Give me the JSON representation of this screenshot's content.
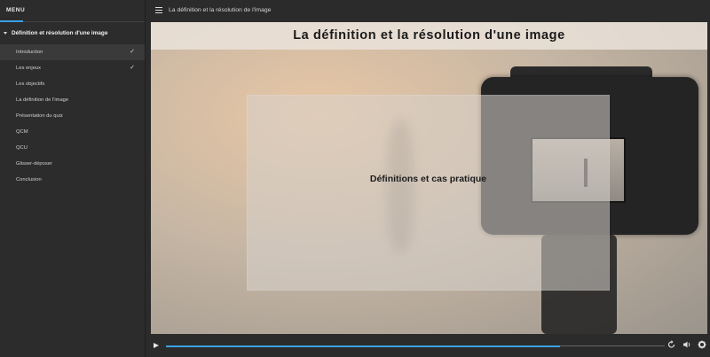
{
  "sidebar": {
    "menu_title": "MENU",
    "section_title": "Définition et résolution d'une image",
    "items": [
      {
        "label": "Introduction",
        "done": true,
        "active": true
      },
      {
        "label": "Les enjeux",
        "done": true,
        "active": false
      },
      {
        "label": "Les objectifs",
        "done": false,
        "active": false
      },
      {
        "label": "La définition de l'image",
        "done": false,
        "active": false
      },
      {
        "label": "Présentation du quiz",
        "done": false,
        "active": false
      },
      {
        "label": "QCM",
        "done": false,
        "active": false
      },
      {
        "label": "QCU",
        "done": false,
        "active": false
      },
      {
        "label": "Glisser-déposer",
        "done": false,
        "active": false
      },
      {
        "label": "Conclusion",
        "done": false,
        "active": false
      }
    ],
    "check_glyph": "✓"
  },
  "topbar": {
    "title": "La définition et la résolution de l'image"
  },
  "slide": {
    "title": "La définition et la résolution d'une image",
    "overlay_text": "Définitions et cas pratique"
  },
  "player": {
    "progress_fraction": 0.79,
    "replay_icon": "replay-icon",
    "volume_icon": "volume-icon",
    "settings_icon": "gear-icon"
  },
  "colors": {
    "accent": "#3aa0e6"
  }
}
